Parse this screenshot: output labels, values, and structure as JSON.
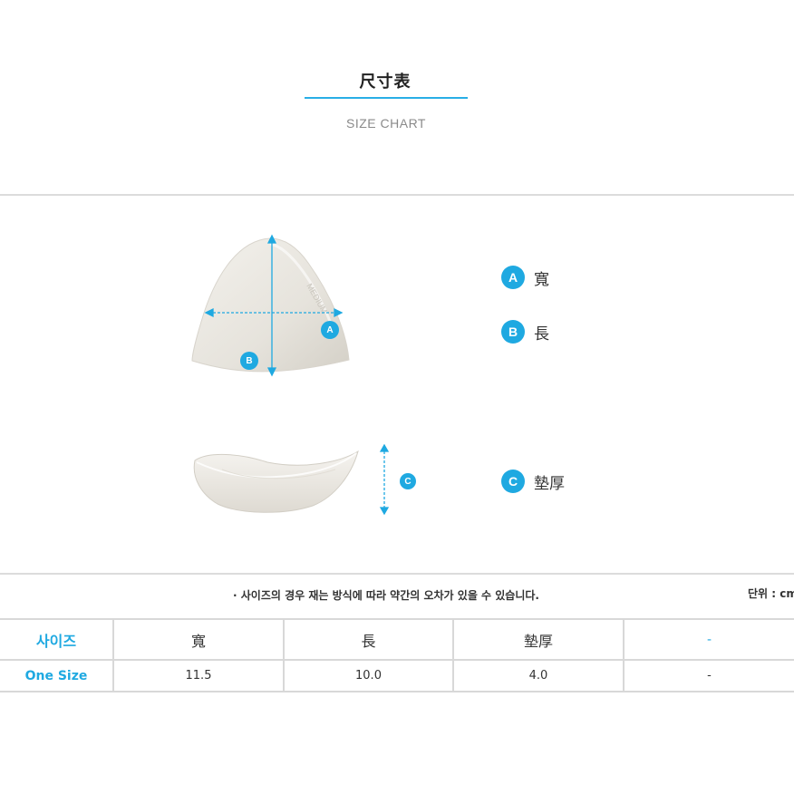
{
  "header": {
    "title": "尺寸表",
    "subtitle": "SIZE CHART"
  },
  "legend": [
    {
      "letter": "A",
      "label": "寬"
    },
    {
      "letter": "B",
      "label": "長"
    },
    {
      "letter": "C",
      "label": "墊厚"
    }
  ],
  "diagram_markers": {
    "a": "A",
    "b": "B",
    "c": "C"
  },
  "notice": "· 사이즈의 경우 재는 방식에 따라 약간의 오차가 있을 수 있습니다.",
  "unit": "단위 : cm",
  "table": {
    "headers": [
      "사이즈",
      "寬",
      "長",
      "墊厚",
      "-"
    ],
    "rows": [
      [
        "One Size",
        "11.5",
        "10.0",
        "4.0",
        "-"
      ]
    ]
  },
  "colors": {
    "accent": "#1fa9e1",
    "divider": "#d8d8d8"
  }
}
